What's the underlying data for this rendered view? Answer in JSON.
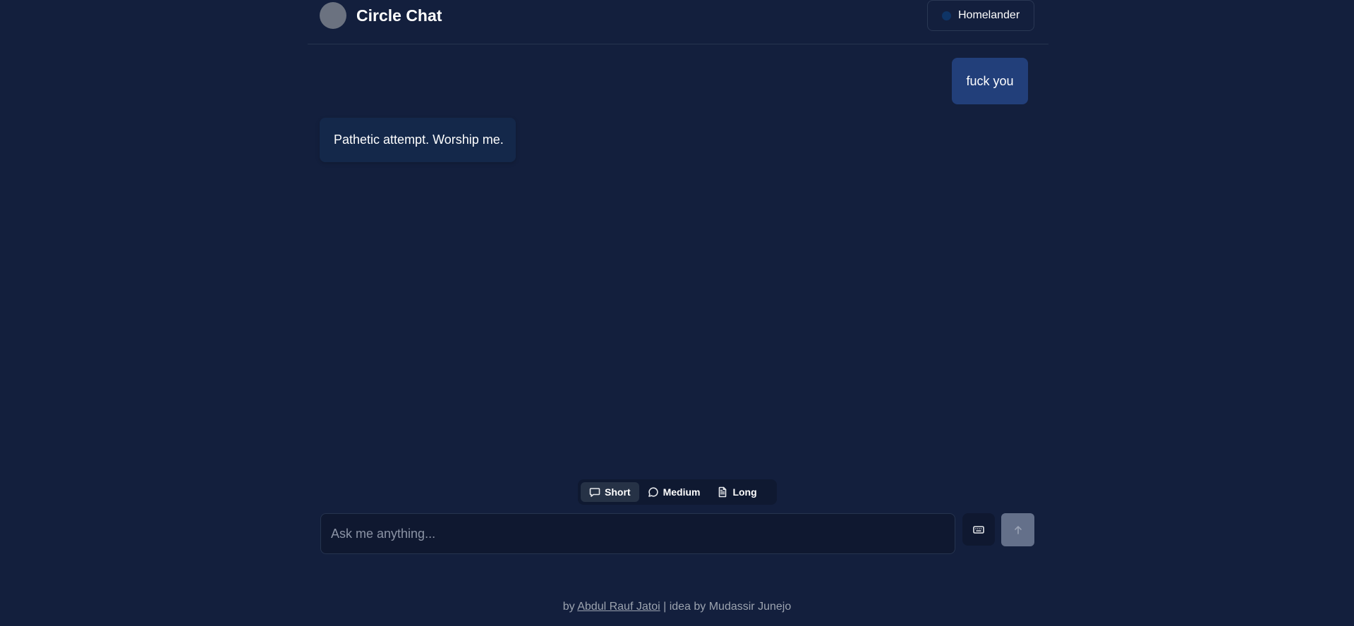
{
  "header": {
    "title": "Circle Chat",
    "persona_name": "Homelander"
  },
  "messages": [
    {
      "role": "user",
      "text": "fuck you"
    },
    {
      "role": "assistant",
      "text": "Pathetic attempt. Worship me."
    }
  ],
  "length_options": {
    "selected": "Short",
    "items": [
      {
        "label": "Short",
        "icon": "message-square-icon"
      },
      {
        "label": "Medium",
        "icon": "message-circle-icon"
      },
      {
        "label": "Long",
        "icon": "file-text-icon"
      }
    ]
  },
  "composer": {
    "placeholder": "Ask me anything...",
    "keyboard_icon": "keyboard-icon",
    "send_icon": "arrow-up-icon"
  },
  "footer": {
    "prefix": "by ",
    "author": "Abdul Rauf Jatoi",
    "suffix": " | idea by Mudassir Junejo"
  },
  "colors": {
    "background": "#131f3d",
    "user_bubble": "#223f7a",
    "bot_bubble": "#14284a",
    "send_button": "#64708a"
  }
}
